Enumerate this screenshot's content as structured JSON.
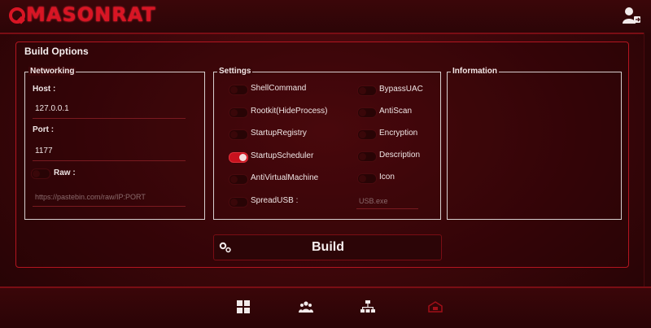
{
  "app": {
    "title": "MASONRAT"
  },
  "panel": {
    "title": "Build Options"
  },
  "networking": {
    "legend": "Networking",
    "host_label": "Host :",
    "host_value": "127.0.0.1",
    "port_label": "Port :",
    "port_value": "1177",
    "raw_label": "Raw :",
    "raw_placeholder": "https://pastebin.com/raw/IP:PORT"
  },
  "settings": {
    "legend": "Settings",
    "left": [
      {
        "label": "ShellCommand",
        "on": false
      },
      {
        "label": "Rootkit(HideProcess)",
        "on": false
      },
      {
        "label": "StartupRegistry",
        "on": false
      },
      {
        "label": "StartupScheduler",
        "on": true
      },
      {
        "label": "AntiVirtualMachine",
        "on": false
      },
      {
        "label": "SpreadUSB :",
        "on": false
      }
    ],
    "right": [
      {
        "label": "BypassUAC",
        "on": false
      },
      {
        "label": "AntiScan",
        "on": false
      },
      {
        "label": "Encryption",
        "on": false
      },
      {
        "label": "Description",
        "on": false
      },
      {
        "label": "Icon",
        "on": false
      }
    ],
    "usb_placeholder": "USB.exe"
  },
  "information": {
    "legend": "Information"
  },
  "build": {
    "label": "Build"
  },
  "colors": {
    "accent": "#d81524",
    "toggle_on": "#c8121e",
    "border": "#b31520"
  },
  "nav": {
    "icons": [
      "dashboard-icon",
      "users-icon",
      "network-icon",
      "builder-icon"
    ]
  }
}
